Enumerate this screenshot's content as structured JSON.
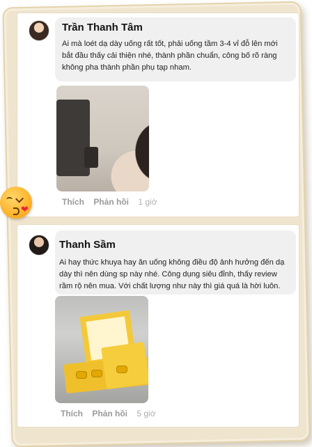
{
  "comments": [
    {
      "author": "Trần Thanh Tâm",
      "text_lines": [
        "Ai mà loét dạ dày uống rất tốt, phải uống tầm 3-4 vỉ đỗ lên mới",
        "bắt đầu thấy cải thiện nhé, thành phần chuẩn, công bố rõ ràng",
        "không pha thành phần phụ tạp nham."
      ],
      "like_label": "Thích",
      "reply_label": "Phản hồi",
      "time": "1 giờ",
      "photo_icon": "woman-drinking-photo"
    },
    {
      "author": "Thanh Sầm",
      "text_lines": [
        "Ai hay thức khuya hay ăn uống không điều độ ảnh hưởng đến dạ",
        "dày thì nên dùng sp này nhé. Công dụng siêu đỉnh, thấy review",
        "rầm rộ nên mua. Với chất lượng như này thì giá quá là hời luôn."
      ],
      "like_label": "Thích",
      "reply_label": "Phản hồi",
      "time": "5 giờ",
      "photo_icon": "yellow-product-box-photo"
    }
  ],
  "decorations": {
    "emoji": "kiss-heart-emoji"
  },
  "colors": {
    "frame": "#efe5cf",
    "bubble": "#f0f0f0",
    "action_text": "#9a9a9a"
  }
}
